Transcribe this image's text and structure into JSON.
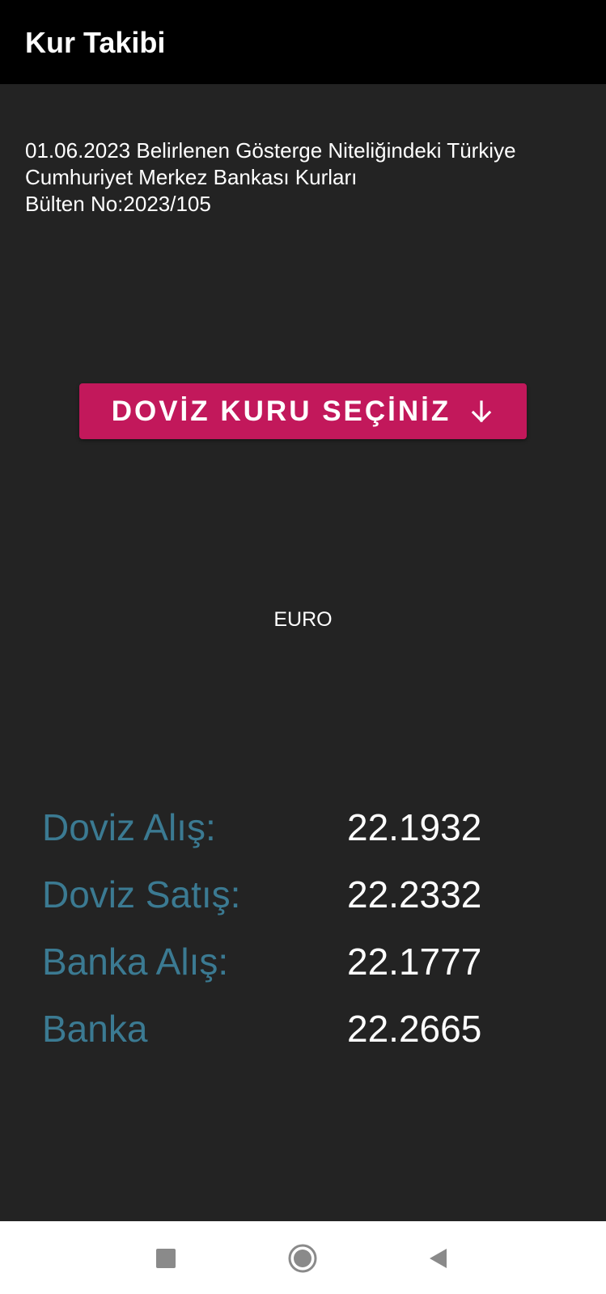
{
  "app_bar": {
    "title": "Kur Takibi"
  },
  "bulletin": {
    "line1": "01.06.2023 Belirlenen Gösterge Niteliğindeki Türkiye",
    "line2": "Cumhuriyet Merkez Bankası Kurları",
    "line3": "Bülten No:2023/105"
  },
  "select_button": {
    "label": "DOVİZ KURU SEÇİNİZ",
    "icon": "arrow-down-icon"
  },
  "currency": {
    "name": "EURO"
  },
  "rates": [
    {
      "label": "Doviz Alış:",
      "value": "22.1932"
    },
    {
      "label": "Doviz Satış:",
      "value": "22.2332"
    },
    {
      "label": "Banka Alış:",
      "value": "22.1777"
    },
    {
      "label": "Banka",
      "value": "22.2665"
    }
  ],
  "nav_bar": {
    "buttons": [
      "recents-square-icon",
      "home-circle-icon",
      "back-triangle-icon"
    ]
  },
  "colors": {
    "app_bar": "#000000",
    "background": "#232323",
    "accent": "#c2185b",
    "rate_label": "#3b7a92",
    "text": "#ffffff"
  }
}
